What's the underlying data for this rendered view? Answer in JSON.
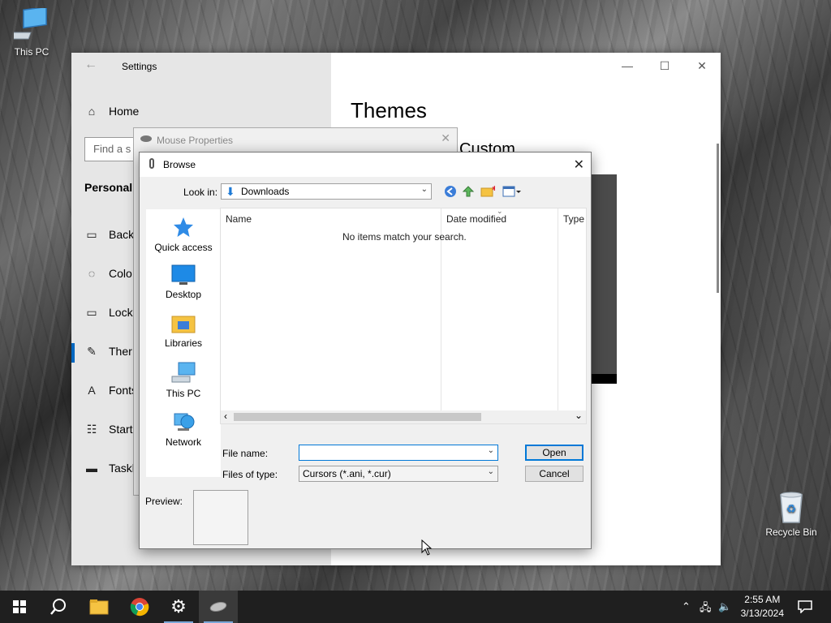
{
  "desktop": {
    "this_pc_label": "This PC",
    "recycle_bin_label": "Recycle Bin"
  },
  "settings": {
    "title": "Settings",
    "home": "Home",
    "search_placeholder": "Find a s",
    "section": "Personaliz",
    "nav": [
      "Back",
      "Colo",
      "Lock",
      "Ther",
      "Fonts",
      "Start",
      "Taskl"
    ],
    "heading": "Themes",
    "subheading": "Custom"
  },
  "mouse_properties": {
    "title": "Mouse Properties"
  },
  "browse": {
    "title": "Browse",
    "look_in_label": "Look in:",
    "look_in_value": "Downloads",
    "places": [
      "Quick access",
      "Desktop",
      "Libraries",
      "This PC",
      "Network"
    ],
    "columns": [
      "Name",
      "Date modified",
      "Type"
    ],
    "empty_message": "No items match your search.",
    "file_name_label": "File name:",
    "file_name_value": "",
    "files_of_type_label": "Files of type:",
    "files_of_type_value": "Cursors (*.ani, *.cur)",
    "open_button": "Open",
    "cancel_button": "Cancel",
    "preview_label": "Preview:"
  },
  "taskbar": {
    "time": "2:55 AM",
    "date": "3/13/2024"
  },
  "colors": {
    "accent": "#0067c0",
    "taskbar": "#1f1f1f",
    "folder_yellow": "#f5c342"
  }
}
